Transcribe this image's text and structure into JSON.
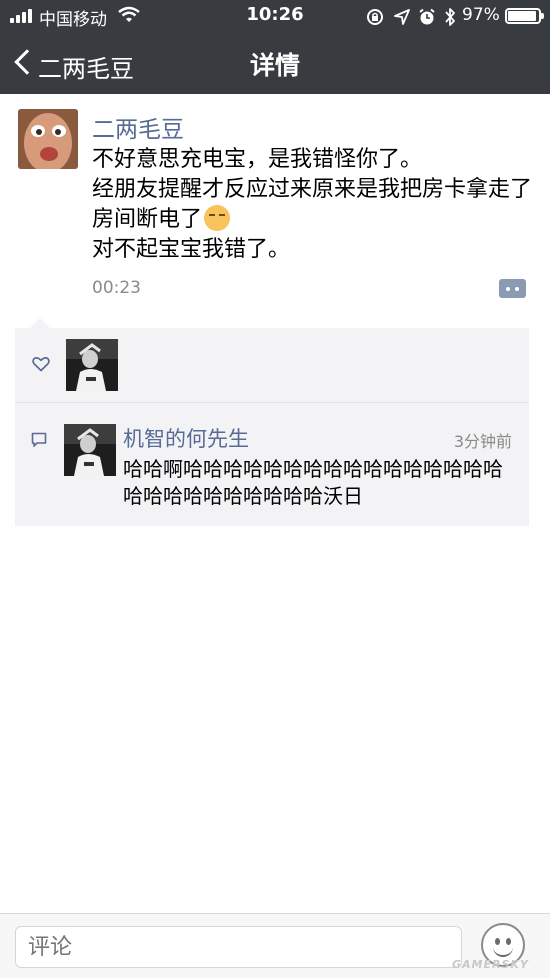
{
  "status_bar": {
    "carrier": "中国移动",
    "time": "10:26",
    "battery_percent": "97%"
  },
  "nav": {
    "back_label": "二两毛豆",
    "title": "详情"
  },
  "post": {
    "author": "二两毛豆",
    "lines": [
      "不好意思充电宝，是我错怪你了。",
      "经朋友提醒才反应过来原来是我把房卡拿走了房间断电了",
      "对不起宝宝我错了。"
    ],
    "time": "00:23"
  },
  "comment": {
    "author": "机智的何先生",
    "time": "3分钟前",
    "text": "哈哈啊哈哈哈哈哈哈哈哈哈哈哈哈哈哈哈哈哈哈哈哈哈哈哈哈哈哈沃日"
  },
  "bottom_bar": {
    "input_placeholder": "评论"
  },
  "watermark": "GAMERSKY",
  "colors": {
    "nav_bg": "#383b40",
    "link_blue": "#576b95",
    "panel_bg": "#f3f3f5"
  },
  "icons": [
    "signal-icon",
    "wifi-icon",
    "lock-rotation-icon",
    "location-icon",
    "alarm-icon",
    "bluetooth-icon",
    "battery-icon",
    "back-chevron-icon",
    "more-icon",
    "heart-icon",
    "comment-icon",
    "emoji-icon"
  ]
}
